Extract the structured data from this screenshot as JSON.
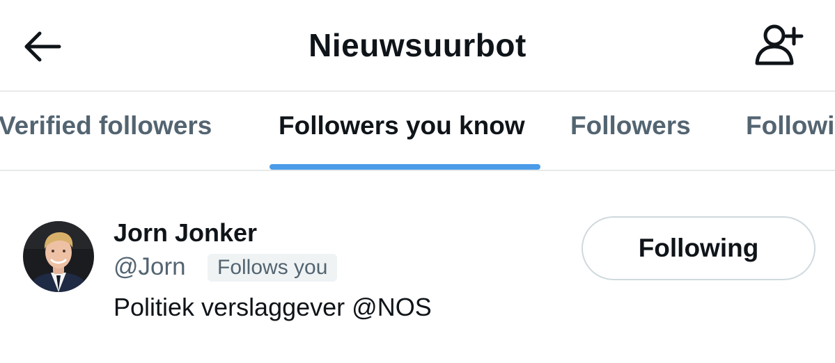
{
  "header": {
    "title": "Nieuwsuurbot",
    "back_icon": "arrow-left-icon",
    "follow_icon": "add-user-icon"
  },
  "tabs": [
    {
      "label": "Verified followers",
      "active": false
    },
    {
      "label": "Followers you know",
      "active": true
    },
    {
      "label": "Followers",
      "active": false
    },
    {
      "label": "Followi",
      "active": false
    }
  ],
  "colors": {
    "accent": "#4a9ce8",
    "text_primary": "#0f1419",
    "text_secondary": "#536471",
    "divider": "#e6e8ea"
  },
  "users": [
    {
      "display_name": "Jorn Jonker",
      "handle": "@Jorn",
      "badge": "Follows you",
      "bio": "Politiek verslaggever @NOS",
      "button_label": "Following",
      "avatar_icon": "profile-photo"
    }
  ]
}
